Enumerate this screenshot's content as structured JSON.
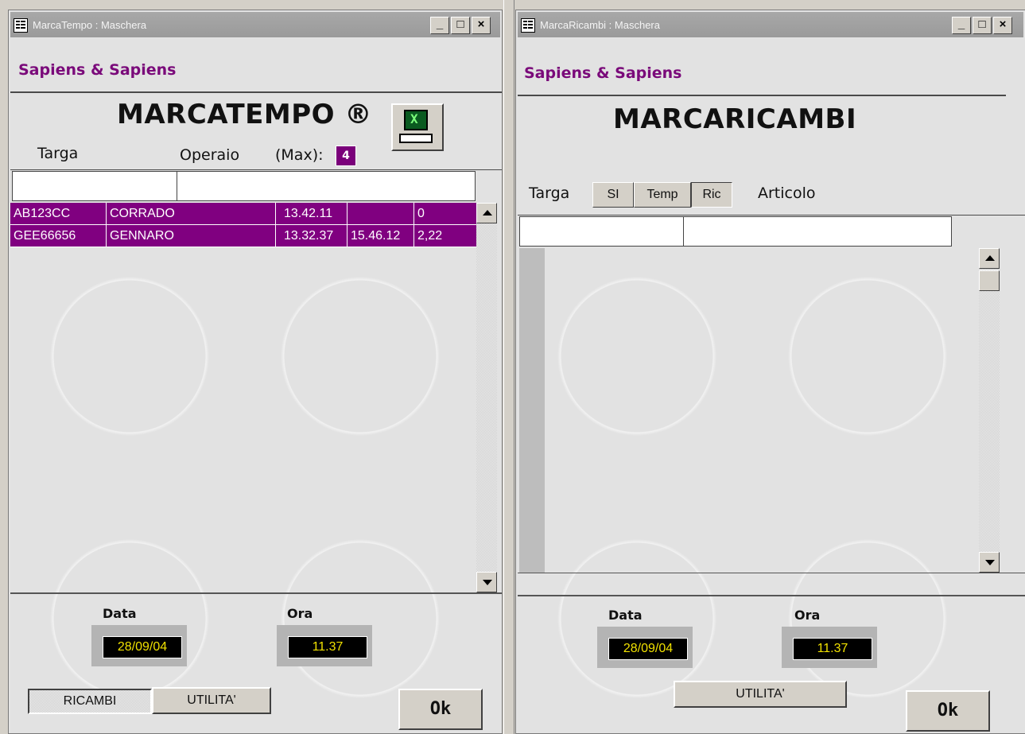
{
  "left_window": {
    "title": "MarcaTempo : Maschera",
    "title_buttons": [
      "_",
      "□",
      "×"
    ],
    "brand": "Sapiens & Sapiens",
    "heading": "MARCATEMPO ®",
    "labels": {
      "targa": "Targa",
      "operaio": "Operaio",
      "max": "(Max):"
    },
    "max_value": "4",
    "rows": [
      [
        "AB123CC",
        "CORRADO",
        "13.42.11",
        "",
        "0"
      ],
      [
        "GEE66656",
        "GENNARO",
        "13.32.37",
        "15.46.12",
        "2,22"
      ]
    ],
    "footer": {
      "data_label": "Data",
      "data_value": "28/09/04",
      "ora_label": "Ora",
      "ora_value": "11.37",
      "ricambi": "RICAMBI",
      "utilita": "UTILITA'",
      "ok": "Ok"
    }
  },
  "right_window": {
    "title": "MarcaRicambi : Maschera",
    "title_buttons": [
      "_",
      "□",
      "×"
    ],
    "brand": "Sapiens & Sapiens",
    "heading": "MARCARICAMBI",
    "labels": {
      "targa": "Targa",
      "articolo": "Articolo"
    },
    "toggles": [
      "SI",
      "Temp",
      "Ric"
    ],
    "footer": {
      "data_label": "Data",
      "data_value": "28/09/04",
      "ora_label": "Ora",
      "ora_value": "11.37",
      "utilita": "UTILITA'",
      "ok": "Ok"
    }
  }
}
